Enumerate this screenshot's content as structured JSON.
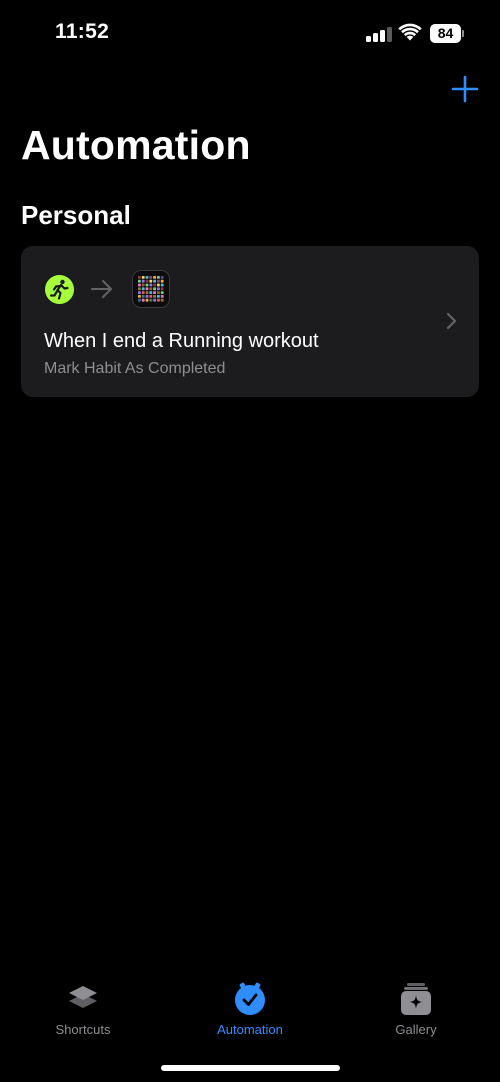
{
  "status_bar": {
    "time": "11:52",
    "battery_level": "84",
    "signal_bars_active": 3,
    "signal_bars_total": 4
  },
  "header": {
    "add_icon": "plus-icon",
    "title": "Automation"
  },
  "section": {
    "title": "Personal"
  },
  "automation_card": {
    "trigger_icon": "running-workout-icon",
    "arrow_icon": "arrow-right-icon",
    "action_icon": "habit-tracker-app-icon",
    "title": "When I end a Running workout",
    "subtitle": "Mark Habit As Completed",
    "chevron_icon": "chevron-right-icon"
  },
  "tab_bar": {
    "tabs": [
      {
        "label": "Shortcuts",
        "icon": "shortcuts-stack-icon",
        "active": false
      },
      {
        "label": "Automation",
        "icon": "automation-clock-check-icon",
        "active": true
      },
      {
        "label": "Gallery",
        "icon": "gallery-sparkle-icon",
        "active": false
      }
    ]
  },
  "colors": {
    "accent": "#2f8dff",
    "background": "#000000",
    "card": "#1c1c1e",
    "secondary_text": "#8e8e93",
    "workout_green": "#a6ff3c"
  }
}
